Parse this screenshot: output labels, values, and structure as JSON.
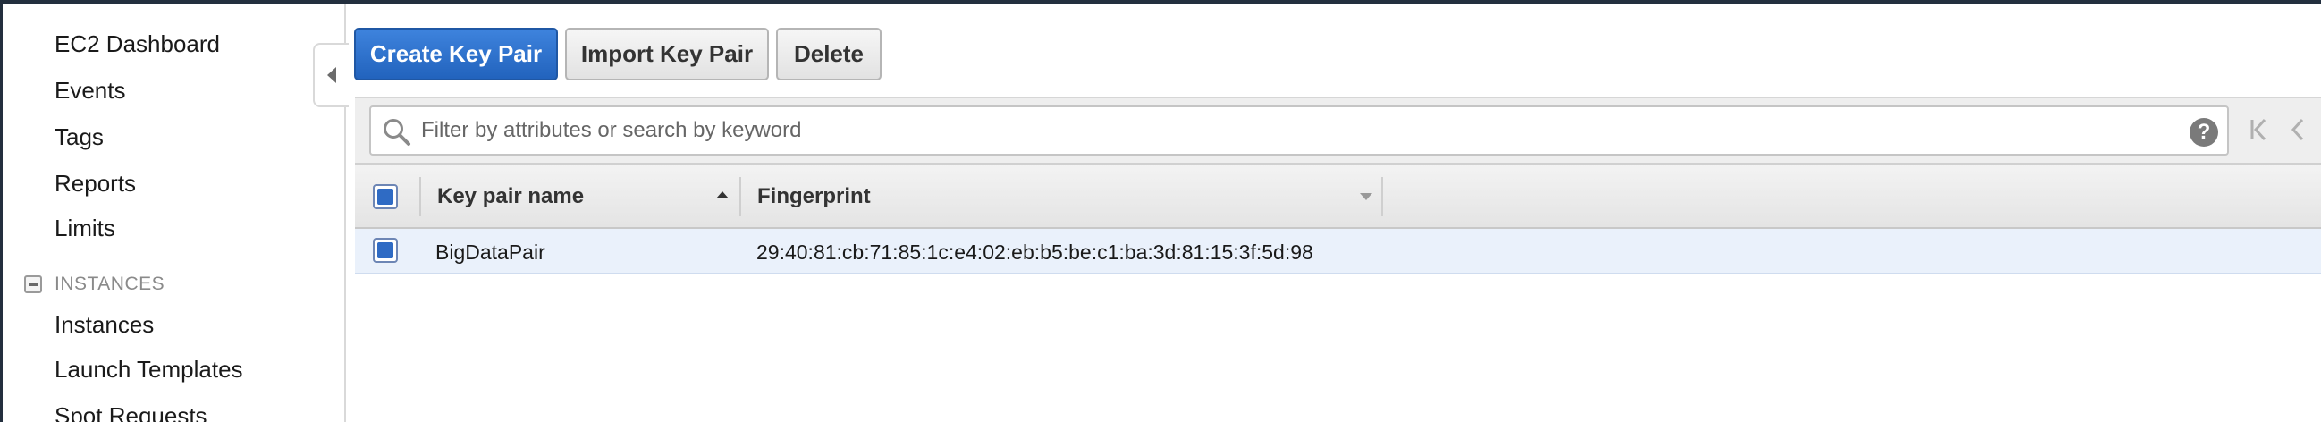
{
  "sidebar": {
    "items": [
      {
        "label": "EC2 Dashboard"
      },
      {
        "label": "Events"
      },
      {
        "label": "Tags"
      },
      {
        "label": "Reports"
      },
      {
        "label": "Limits"
      }
    ],
    "section": {
      "label": "INSTANCES"
    },
    "section_items": [
      {
        "label": "Instances"
      },
      {
        "label": "Launch Templates"
      },
      {
        "label": "Spot Requests"
      }
    ]
  },
  "toolbar": {
    "create_label": "Create Key Pair",
    "import_label": "Import Key Pair",
    "delete_label": "Delete"
  },
  "search": {
    "placeholder": "Filter by attributes or search by keyword",
    "help": "?"
  },
  "table": {
    "columns": [
      {
        "label": "Key pair name",
        "sort": "ascending"
      },
      {
        "label": "Fingerprint"
      }
    ],
    "rows": [
      {
        "name": "BigDataPair",
        "fingerprint": "29:40:81:cb:71:85:1c:e4:02:eb:b5:be:c1:ba:3d:81:15:3f:5d:98",
        "selected": true
      }
    ]
  },
  "colors": {
    "primary_button": "#2f72d0",
    "selected_row": "#eaf1fb",
    "checkbox_fill": "#2f6bc4"
  }
}
